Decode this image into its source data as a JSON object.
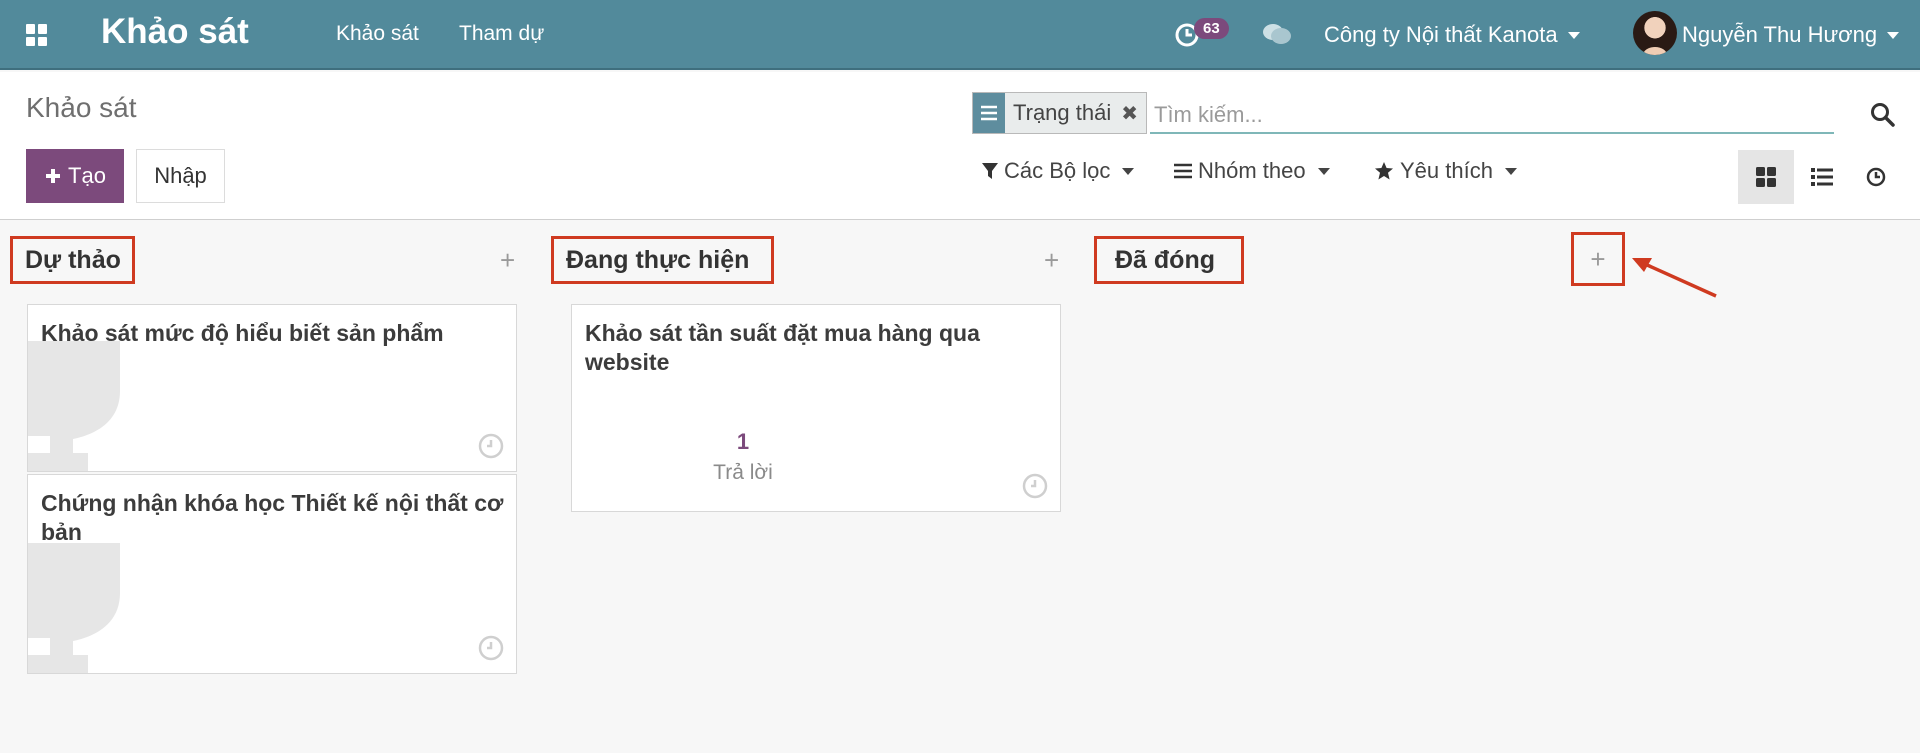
{
  "navbar": {
    "brand": "Khảo sát",
    "menu": [
      "Khảo sát",
      "Tham dự"
    ],
    "activity_count": "63",
    "company": "Công ty Nội thất Kanota",
    "user": "Nguyễn Thu Hương"
  },
  "control": {
    "breadcrumb": "Khảo sát",
    "create_label": "Tạo",
    "import_label": "Nhập",
    "facet_label": "Trạng thái",
    "search_placeholder": "Tìm kiếm...",
    "filters_label": "Các Bộ lọc",
    "group_by_label": "Nhóm theo",
    "favorites_label": "Yêu thích"
  },
  "columns": [
    {
      "title": "Dự thảo",
      "cards": [
        {
          "title": "Khảo sát mức độ hiểu biết sản phẩm"
        },
        {
          "title": "Chứng nhận khóa học Thiết kế nội thất cơ bản"
        }
      ]
    },
    {
      "title": "Đang thực hiện",
      "cards": [
        {
          "title": "Khảo sát tần suất đặt mua hàng qua website",
          "count": "1",
          "count_label": "Trả lời"
        }
      ]
    },
    {
      "title": "Đã đóng",
      "cards": []
    }
  ],
  "colors": {
    "navbar": "#528a9b",
    "primary": "#7c4a7c",
    "highlight": "#cf3a20"
  },
  "icons": [
    "apps-icon",
    "clock-icon",
    "chat-icon",
    "search-icon",
    "filter-icon",
    "list-icon",
    "star-icon",
    "kanban-view-icon",
    "list-view-icon",
    "activity-view-icon",
    "trophy-icon",
    "plus-icon"
  ]
}
